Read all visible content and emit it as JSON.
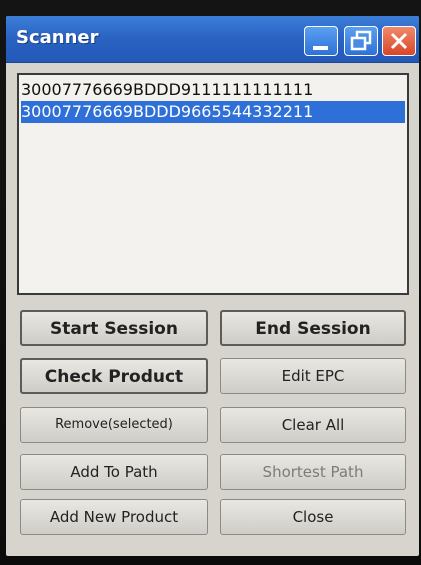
{
  "window": {
    "title": "Scanner"
  },
  "list": {
    "items": [
      {
        "text": "30007776669BDDD9111111111111",
        "selected": false
      },
      {
        "text": "30007776669BDDD9665544332211",
        "selected": true
      }
    ]
  },
  "buttons": {
    "start_session": "Start Session",
    "end_session": "End Session",
    "check_product": "Check Product",
    "edit_epc": "Edit EPC",
    "remove_selected": "Remove(selected)",
    "clear_all": "Clear All",
    "add_to_path": "Add To Path",
    "shortest_path": "Shortest Path",
    "add_new_product": "Add New Product",
    "close": "Close"
  },
  "icons": {
    "minimize": "minimize-icon",
    "maximize": "maximize-icon",
    "close": "close-icon"
  },
  "colors": {
    "titlebar": "#2a64c4",
    "selection": "#2e6fd8",
    "close_button": "#d9452a"
  }
}
